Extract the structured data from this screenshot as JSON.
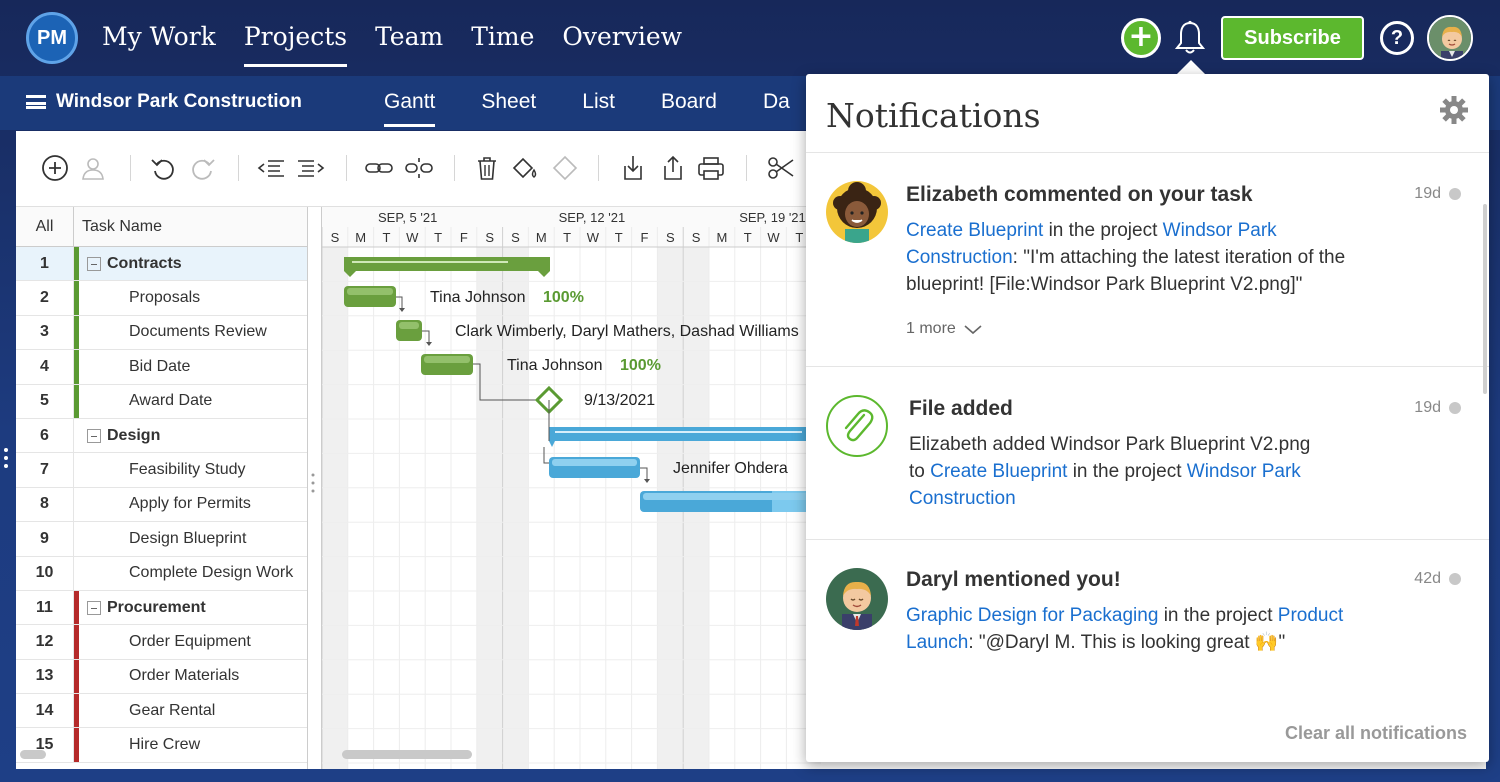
{
  "app": {
    "logo": "PM"
  },
  "topnav": {
    "items": [
      "My Work",
      "Projects",
      "Team",
      "Time",
      "Overview"
    ],
    "active": "Projects"
  },
  "header_actions": {
    "add_label": "+",
    "subscribe_label": "Subscribe",
    "help_label": "?"
  },
  "project": {
    "name": "Windsor Park Construction"
  },
  "views": {
    "items": [
      "Gantt",
      "Sheet",
      "List",
      "Board",
      "Da"
    ],
    "active": "Gantt"
  },
  "toolbar": {
    "icons": [
      "add-task-icon",
      "assign-user-icon",
      "undo-icon",
      "redo-icon",
      "outdent-icon",
      "indent-icon",
      "link-icon",
      "unlink-icon",
      "delete-icon",
      "fill-color-icon",
      "milestone-icon",
      "import-icon",
      "export-icon",
      "print-icon",
      "cut-icon"
    ]
  },
  "grid": {
    "header_all": "All",
    "header_task": "Task Name",
    "rows": [
      {
        "num": "1",
        "name": "Contracts",
        "parent": true,
        "color": "#5a9a32"
      },
      {
        "num": "2",
        "name": "Proposals",
        "parent": false,
        "color": "#5a9a32"
      },
      {
        "num": "3",
        "name": "Documents Review",
        "parent": false,
        "color": "#5a9a32"
      },
      {
        "num": "4",
        "name": "Bid Date",
        "parent": false,
        "color": "#5a9a32"
      },
      {
        "num": "5",
        "name": "Award Date",
        "parent": false,
        "color": "#5a9a32"
      },
      {
        "num": "6",
        "name": "Design",
        "parent": true,
        "color": ""
      },
      {
        "num": "7",
        "name": "Feasibility Study",
        "parent": false,
        "color": ""
      },
      {
        "num": "8",
        "name": "Apply for Permits",
        "parent": false,
        "color": ""
      },
      {
        "num": "9",
        "name": "Design Blueprint",
        "parent": false,
        "color": ""
      },
      {
        "num": "10",
        "name": "Complete Design Work",
        "parent": false,
        "color": ""
      },
      {
        "num": "11",
        "name": "Procurement",
        "parent": true,
        "color": "#b52a2a"
      },
      {
        "num": "12",
        "name": "Order Equipment",
        "parent": false,
        "color": "#b52a2a"
      },
      {
        "num": "13",
        "name": "Order Materials",
        "parent": false,
        "color": "#b52a2a"
      },
      {
        "num": "14",
        "name": "Gear Rental",
        "parent": false,
        "color": "#b52a2a"
      },
      {
        "num": "15",
        "name": "Hire Crew",
        "parent": false,
        "color": "#b52a2a"
      }
    ]
  },
  "gantt": {
    "weeks": [
      "SEP, 5 '21",
      "SEP, 12 '21",
      "SEP, 19 '21"
    ],
    "days": [
      "S",
      "M",
      "T",
      "W",
      "T",
      "F",
      "S",
      "S",
      "M",
      "T",
      "W",
      "T",
      "F",
      "S",
      "S",
      "M",
      "T",
      "W",
      "T"
    ],
    "labels": {
      "proposals": "Tina Johnson",
      "proposals_pct": "100%",
      "docs": "Clark Wimberly, Daryl Mathers, Dashad Williams",
      "bid": "Tina Johnson",
      "bid_pct": "100%",
      "award": "9/13/2021",
      "feas": "Jennifer Ohdera"
    },
    "colors": {
      "green": "#6a9f3e",
      "blue": "#4aa8d8"
    }
  },
  "notifications": {
    "title": "Notifications",
    "items": [
      {
        "title": "Elizabeth commented on your task",
        "time": "19d",
        "link1": "Create Blueprint",
        "mid": " in the project ",
        "link2": "Windsor Park Construction",
        "text": ": \"I'm attaching the latest iteration of the blueprint! [File:Windsor Park Blueprint V2.png]\"",
        "more": "1 more"
      },
      {
        "title": "File added",
        "time": "19d",
        "text": "Elizabeth added Windsor Park Blueprint V2.png to ",
        "link1": "Create Blueprint",
        "mid": " in the project ",
        "link2": "Windsor Park Construction"
      },
      {
        "title": "Daryl mentioned you!",
        "time": "42d",
        "link1": "Graphic Design for Packaging",
        "mid": " in the project ",
        "link2": "Product Launch",
        "text": ": \"@Daryl M. This is looking great 🙌\""
      }
    ],
    "clear_label": "Clear all notifications"
  }
}
